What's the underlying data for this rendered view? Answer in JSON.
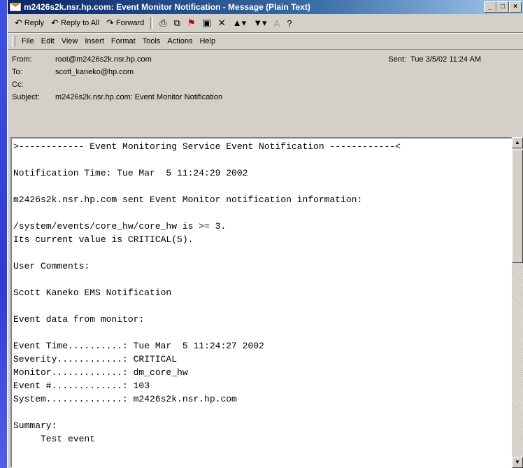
{
  "window": {
    "title": "m2426s2k.nsr.hp.com: Event Monitor Notification - Message (Plain Text)",
    "min": "_",
    "max": "□",
    "close": "×"
  },
  "toolbar": {
    "reply": "Reply",
    "reply_all": "Reply to All",
    "forward": "Forward"
  },
  "menu": [
    "File",
    "Edit",
    "View",
    "Insert",
    "Format",
    "Tools",
    "Actions",
    "Help"
  ],
  "header": {
    "from_label": "From:",
    "from": "root@m2426s2k.nsr.hp.com",
    "to_label": "To:",
    "to": "scott_kaneko@hp.com",
    "cc_label": "Cc:",
    "cc": "",
    "subject_label": "Subject:",
    "subject": "m2426s2k.nsr.hp.com: Event Monitor Notification",
    "sent_label": "Sent:",
    "sent": "Tue 3/5/02 11:24 AM"
  },
  "body": ">------------ Event Monitoring Service Event Notification ------------<\n\nNotification Time: Tue Mar  5 11:24:29 2002\n\nm2426s2k.nsr.hp.com sent Event Monitor notification information:\n\n/system/events/core_hw/core_hw is >= 3.\nIts current value is CRITICAL(5).\n\nUser Comments:\n\nScott Kaneko EMS Notification\n\nEvent data from monitor:\n\nEvent Time..........: Tue Mar  5 11:24:27 2002\nSeverity............: CRITICAL\nMonitor.............: dm_core_hw\nEvent #.............: 103\nSystem..............: m2426s2k.nsr.hp.com\n\nSummary:\n     Test event"
}
